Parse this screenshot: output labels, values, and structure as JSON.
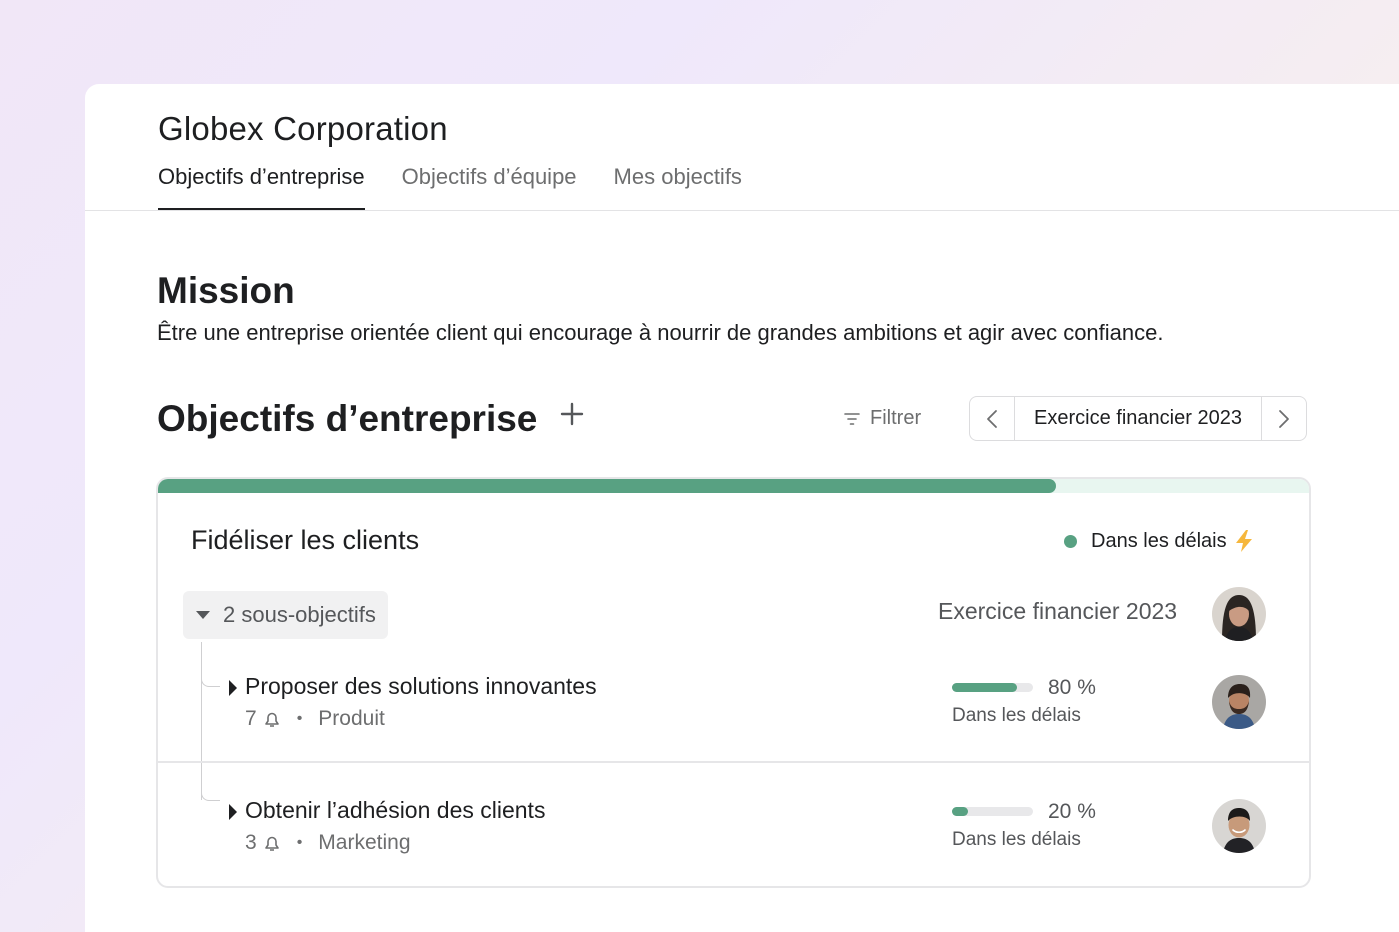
{
  "header": {
    "company": "Globex Corporation",
    "tabs": [
      {
        "label": "Objectifs d’entreprise",
        "active": true
      },
      {
        "label": "Objectifs d’équipe",
        "active": false
      },
      {
        "label": "Mes objectifs",
        "active": false
      }
    ]
  },
  "mission": {
    "heading": "Mission",
    "text": "Être une entreprise orientée client qui encourage à nourrir de grandes ambitions et agir avec confiance."
  },
  "goals_section": {
    "heading": "Objectifs d’entreprise",
    "add_icon": "plus-icon",
    "filter_label": "Filtrer",
    "period_label": "Exercice financier 2023"
  },
  "goal": {
    "progress": 0.78,
    "title": "Fidéliser les clients",
    "status": "Dans les délais",
    "status_color": "#58a182",
    "status_icon": "lightning-icon",
    "subgoals_toggle": "2 sous-objectifs",
    "period": "Exercice financier 2023",
    "owner_avatar": "avatar-woman",
    "subgoals": [
      {
        "title": "Proposer des solutions innovantes",
        "count": "7",
        "team": "Produit",
        "progress": 0.8,
        "progress_label": "80 %",
        "status": "Dans les délais",
        "avatar": "avatar-man-beard"
      },
      {
        "title": "Obtenir l’adhésion des clients",
        "count": "3",
        "team": "Marketing",
        "progress": 0.2,
        "progress_label": "20 %",
        "status": "Dans les délais",
        "avatar": "avatar-man-smiling"
      }
    ]
  },
  "colors": {
    "accent_green": "#58a182",
    "progress_track": "#e8f6f0",
    "bolt": "#f6b73c"
  }
}
